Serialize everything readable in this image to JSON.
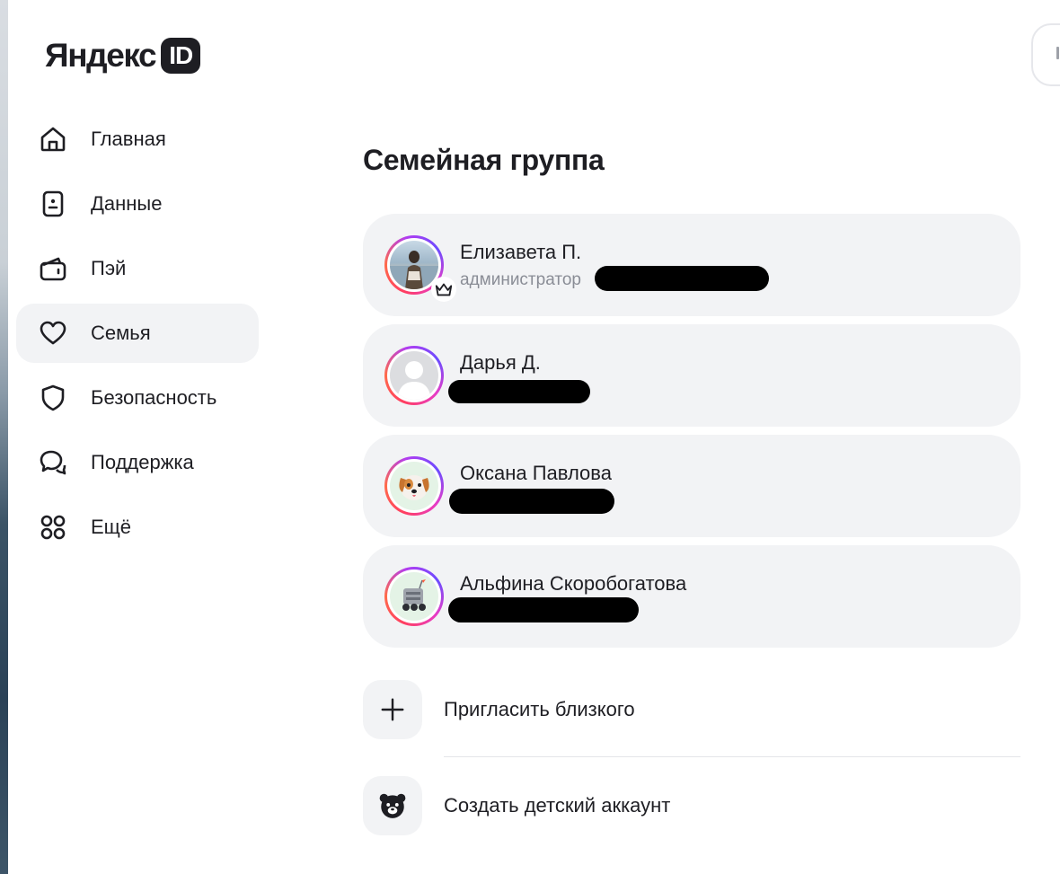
{
  "brand": {
    "word": "Яндекс",
    "badge": "ID"
  },
  "nav": {
    "items": [
      {
        "label": "Главная",
        "icon": "home-icon",
        "active": false
      },
      {
        "label": "Данные",
        "icon": "id-card-icon",
        "active": false
      },
      {
        "label": "Пэй",
        "icon": "wallet-icon",
        "active": false
      },
      {
        "label": "Семья",
        "icon": "heart-icon",
        "active": true
      },
      {
        "label": "Безопасность",
        "icon": "shield-icon",
        "active": false
      },
      {
        "label": "Поддержка",
        "icon": "chat-icon",
        "active": false
      },
      {
        "label": "Ещё",
        "icon": "grid-icon",
        "active": false
      }
    ]
  },
  "page": {
    "title": "Семейная группа"
  },
  "members": [
    {
      "name": "Елизавета П.",
      "role": "администратор",
      "avatar": "photo-avatar",
      "badge": "crown-icon"
    },
    {
      "name": "Дарья Д.",
      "role": "",
      "avatar": "default-user-avatar"
    },
    {
      "name": "Оксана Павлова",
      "role": "",
      "avatar": "dog-avatar"
    },
    {
      "name": "Альфина Скоробогатова",
      "role": "",
      "avatar": "robot-avatar"
    }
  ],
  "actions": {
    "invite": {
      "label": "Пригласить близкого",
      "icon": "plus-icon"
    },
    "child": {
      "label": "Создать детский аккаунт",
      "icon": "bear-icon"
    }
  },
  "colors": {
    "surface": "#f2f3f5",
    "text": "#1e1e23",
    "muted": "#8a8d96"
  }
}
